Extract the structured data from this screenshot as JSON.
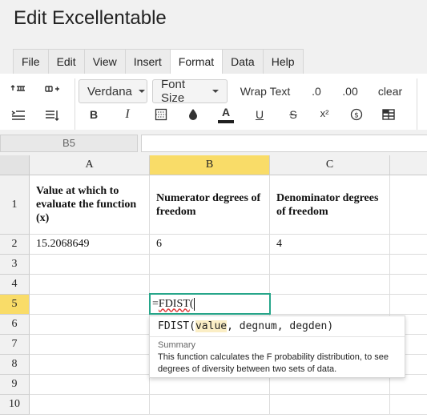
{
  "app": {
    "title": "Edit Excellentable"
  },
  "menu": {
    "items": [
      {
        "label": "File"
      },
      {
        "label": "Edit"
      },
      {
        "label": "View"
      },
      {
        "label": "Insert"
      },
      {
        "label": "Format",
        "active": true
      },
      {
        "label": "Data"
      },
      {
        "label": "Help"
      }
    ]
  },
  "toolbar": {
    "font_family": "Verdana",
    "font_size": "Font Size",
    "wrap_text": "Wrap Text",
    "dec_decrease": ".0",
    "dec_increase": ".00",
    "clear": "clear",
    "bold": "B",
    "italic": "I",
    "text_color_letter": "A",
    "underline": "U",
    "strike": "S",
    "superscript": "x²",
    "accent_color": "#1f1f1f"
  },
  "formula_bar": {
    "cell_ref": "B5",
    "value": ""
  },
  "grid": {
    "columns": [
      "A",
      "B",
      "C"
    ],
    "rows": [
      {
        "num": "1",
        "cells": [
          "Value at which to evaluate the function (x)",
          "Numerator degrees of freedom",
          "Denominator degrees of freedom"
        ]
      },
      {
        "num": "2",
        "cells": [
          "15.2068649",
          "6",
          "4"
        ]
      },
      {
        "num": "3",
        "cells": [
          "",
          "",
          ""
        ]
      },
      {
        "num": "4",
        "cells": [
          "",
          "",
          ""
        ]
      },
      {
        "num": "5",
        "cells": [
          "",
          "",
          ""
        ]
      },
      {
        "num": "6",
        "cells": [
          "",
          "",
          ""
        ]
      },
      {
        "num": "7",
        "cells": [
          "",
          "",
          ""
        ]
      },
      {
        "num": "8",
        "cells": [
          "",
          "",
          ""
        ]
      },
      {
        "num": "9",
        "cells": [
          "",
          "",
          ""
        ]
      },
      {
        "num": "10",
        "cells": [
          "",
          "",
          ""
        ]
      }
    ],
    "selected_column": "B",
    "selected_row": "5",
    "selection_color": "#f9dc68",
    "editor_border_color": "#27a68a"
  },
  "editor": {
    "prefix": "=",
    "function_name": "FDIST",
    "open_paren": "("
  },
  "tooltip": {
    "sig_fn": "FDIST(",
    "sig_value": "value",
    "sig_rest": ", degnum, degden)",
    "summary_label": "Summary",
    "summary_text": "This function calculates the F probability distribution, to see degrees of diversity between two sets of data."
  }
}
